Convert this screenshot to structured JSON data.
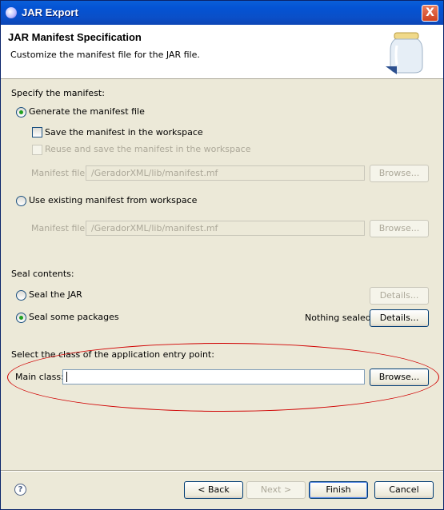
{
  "window": {
    "title": "JAR Export",
    "close_glyph": "X"
  },
  "banner": {
    "title": "JAR Manifest Specification",
    "subtitle": "Customize the manifest file for the JAR file."
  },
  "manifest": {
    "section_label": "Specify the manifest:",
    "generate_label": "Generate the manifest file",
    "save_label": "Save the manifest in the workspace",
    "reuse_label": "Reuse and save the manifest in the workspace",
    "manifest_file_label": "Manifest file:",
    "manifest_file_value": "/GeradorXML/lib/manifest.mf",
    "browse_label": "Browse...",
    "use_existing_label": "Use existing manifest from workspace",
    "existing_file_label": "Manifest file:",
    "existing_file_value": "/GeradorXML/lib/manifest.mf",
    "existing_browse_label": "Browse..."
  },
  "seal": {
    "section_label": "Seal contents:",
    "seal_jar_label": "Seal the JAR",
    "seal_jar_details": "Details...",
    "seal_some_label": "Seal some packages",
    "nothing_sealed": "Nothing sealed",
    "seal_some_details": "Details..."
  },
  "entry": {
    "section_label": "Select the class of the application entry point:",
    "main_class_label": "Main class:",
    "main_class_value": "",
    "browse_label": "Browse..."
  },
  "footer": {
    "help_glyph": "?",
    "back_label": "< Back",
    "next_label": "Next >",
    "finish_label": "Finish",
    "cancel_label": "Cancel"
  },
  "colors": {
    "annotation": "#d00000",
    "titlebar": "#0453d4",
    "dialog_bg": "#ece9d8"
  }
}
